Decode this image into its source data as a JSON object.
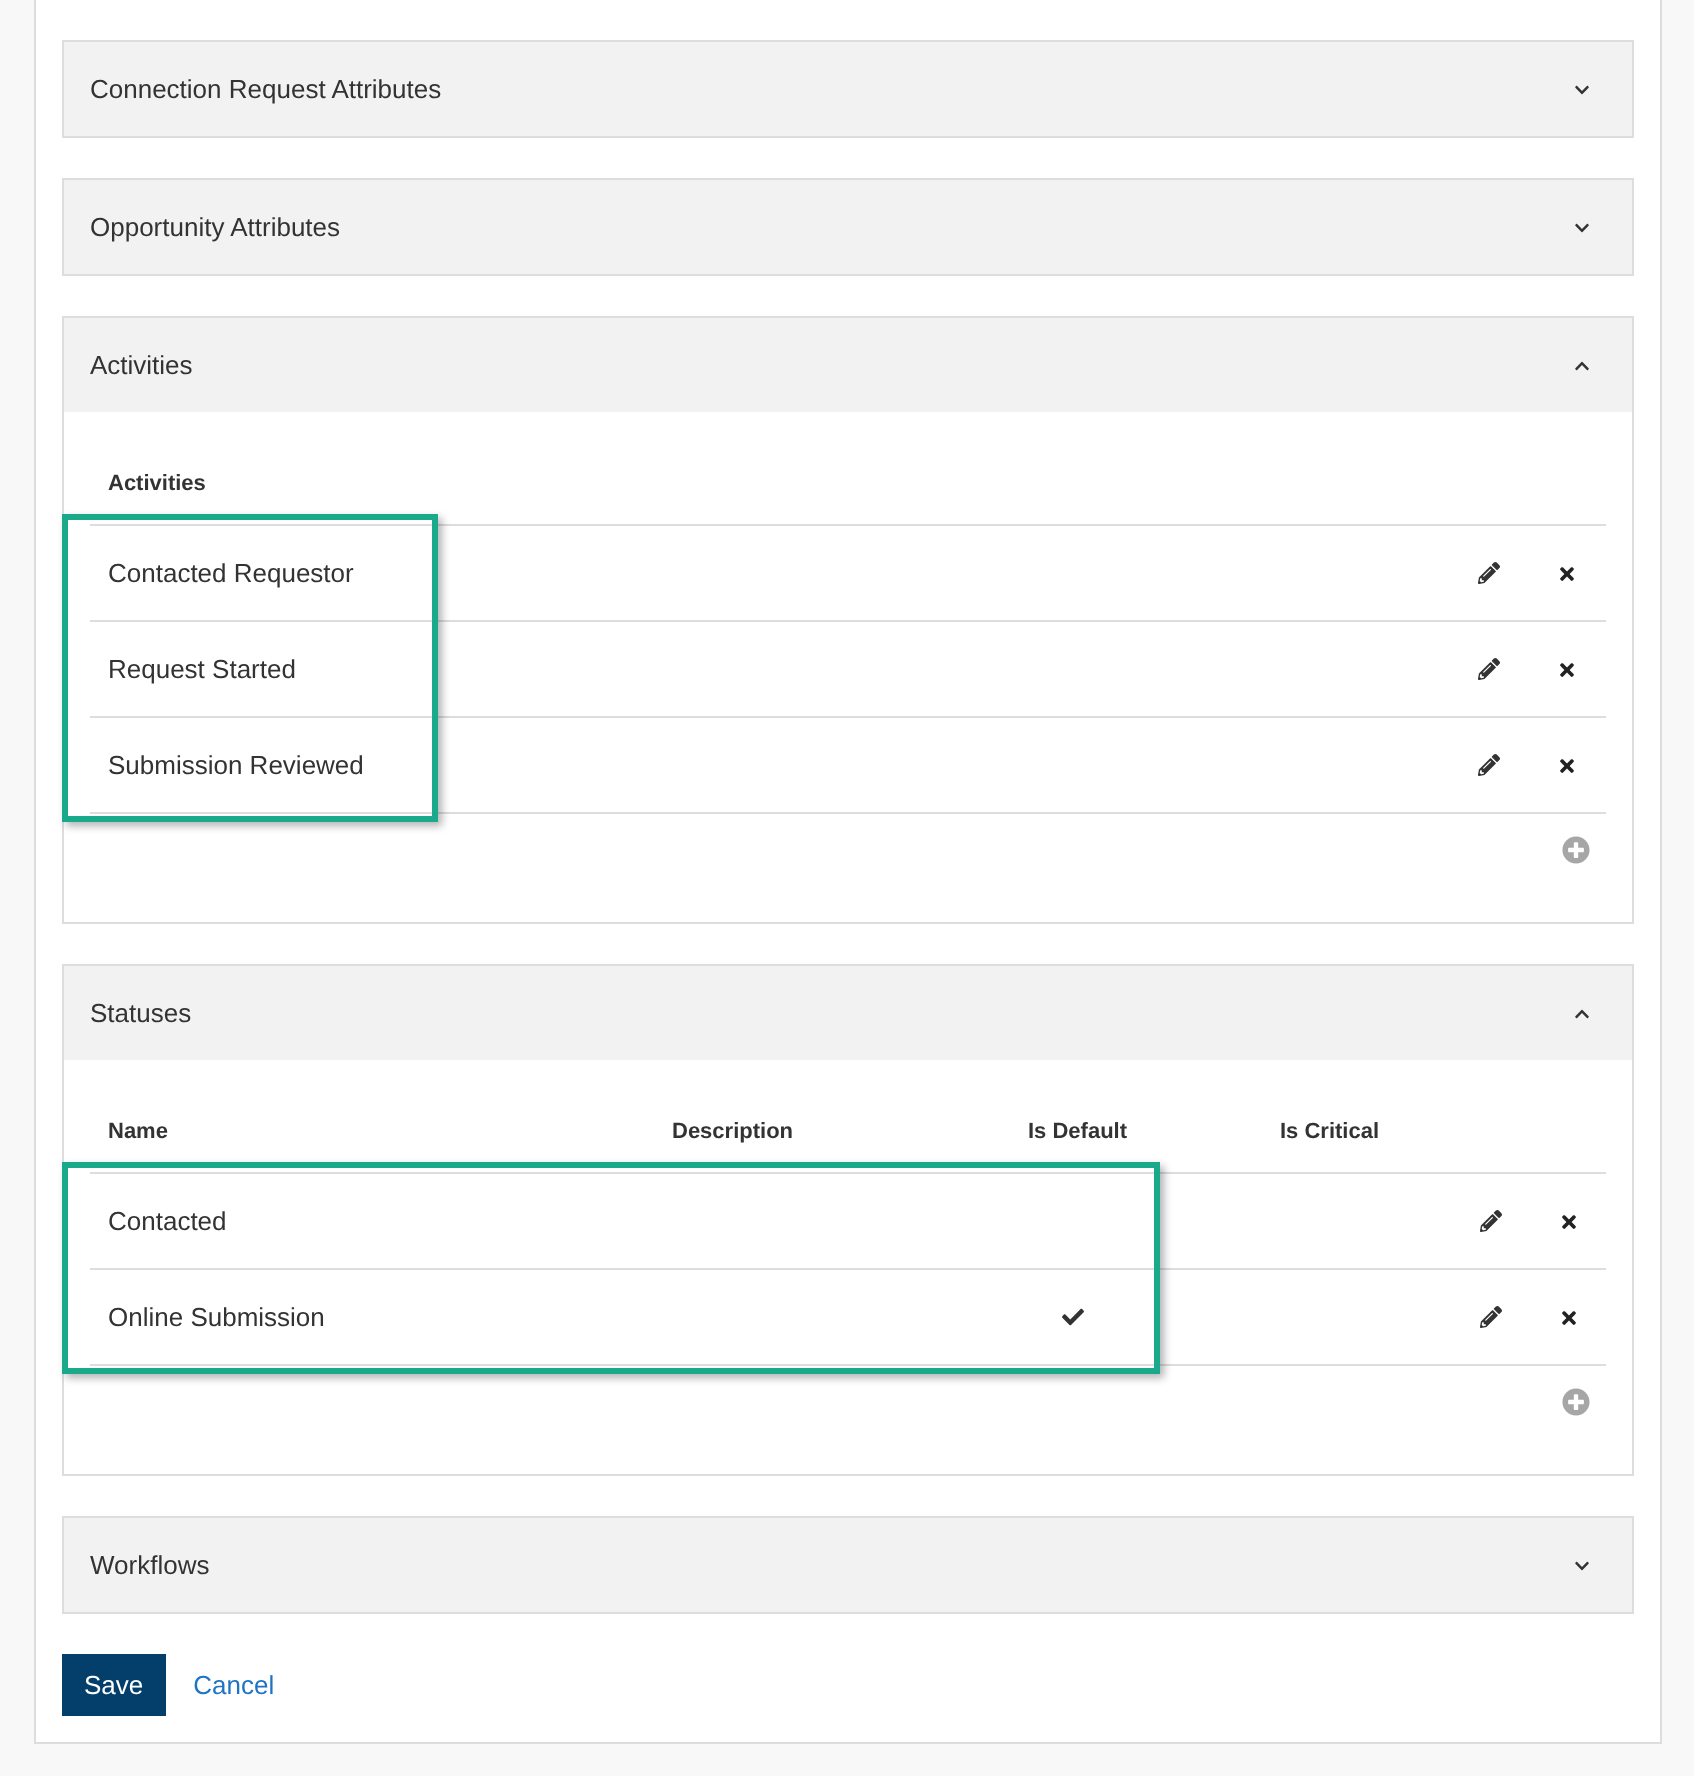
{
  "panels": [
    {
      "title": "Connection Request Attributes",
      "expanded": false
    },
    {
      "title": "Opportunity Attributes",
      "expanded": false
    },
    {
      "title": "Activities",
      "expanded": true,
      "table": {
        "kind": "list",
        "columns": [
          {
            "label": "Activities",
            "highlighted": true
          }
        ],
        "rows": [
          {
            "cells": [
              "Contacted Requestor"
            ]
          },
          {
            "cells": [
              "Request Started"
            ]
          },
          {
            "cells": [
              "Submission Reviewed"
            ]
          }
        ]
      }
    },
    {
      "title": "Statuses",
      "expanded": true,
      "table": {
        "kind": "status",
        "columns": [
          {
            "label": "Name",
            "highlighted": true
          },
          {
            "label": "Description",
            "highlighted": true
          },
          {
            "label": "Is Default",
            "highlighted": true
          },
          {
            "label": "Is Critical",
            "highlighted": false
          }
        ],
        "rows": [
          {
            "name": "Contacted",
            "is_default": false,
            "is_critical": false
          },
          {
            "name": "Online Submission",
            "is_default": true,
            "is_critical": false
          }
        ]
      }
    },
    {
      "title": "Workflows",
      "expanded": false
    }
  ],
  "actions": {
    "save": "Save",
    "cancel": "Cancel"
  }
}
